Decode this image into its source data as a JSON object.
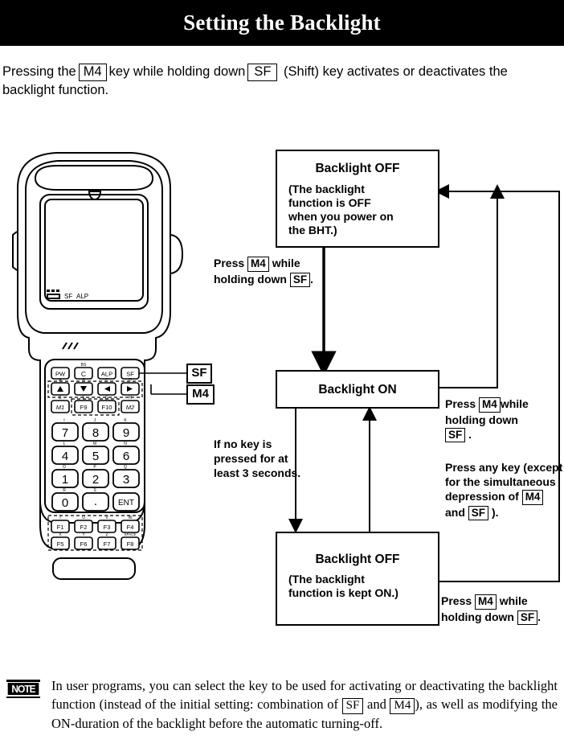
{
  "header": {
    "title": "Setting the Backlight"
  },
  "intro": {
    "part1": "Pressing the",
    "key1": "M4",
    "part2": "key while holding down",
    "key2": "SF",
    "part3": "(Shift) key activates or deactivates the backlight function."
  },
  "device": {
    "name": "BHT handheld terminal",
    "status_indicators": [
      "SF",
      "ALP"
    ],
    "keys": {
      "row_function": [
        "PW",
        "C",
        "ALP",
        "SF"
      ],
      "row_function_shift": [
        "BS"
      ],
      "row_arrows": [
        "up-arrow",
        "down-arrow",
        "left-arrow",
        "right-arrow"
      ],
      "row_arrows_shift": [
        "A",
        "B",
        "C",
        "D"
      ],
      "row_m": [
        "M1",
        "F9",
        "F10",
        "M2"
      ],
      "row_m_shift": [
        "E",
        "F",
        "G",
        "H"
      ],
      "row_789": [
        "7",
        "8",
        "9"
      ],
      "row_789_shift": [
        "I",
        "J",
        "K"
      ],
      "row_456": [
        "4",
        "5",
        "6"
      ],
      "row_456_shift": [
        "L",
        "M",
        "N"
      ],
      "row_123": [
        "1",
        "2",
        "3"
      ],
      "row_123_shift": [
        "O",
        "P",
        "Q"
      ],
      "row_0": [
        "0",
        ".",
        "ENT"
      ],
      "row_0_shift": [
        "R",
        "S"
      ],
      "row_f1": [
        "F1",
        "F2",
        "F3",
        "F4"
      ],
      "row_f1_shift": [
        "T",
        "U",
        "V",
        "W"
      ],
      "row_f5": [
        "F5",
        "F6",
        "F7",
        "F8"
      ],
      "row_f5_shift": [
        "X",
        "Y",
        "Z",
        "SPACE"
      ]
    }
  },
  "callouts": {
    "sf": "SF",
    "m4": "M4"
  },
  "flowchart": {
    "box_off_initial": {
      "title": "Backlight OFF",
      "sub_lines": [
        "(The backlight",
        "function is OFF",
        "when you power on",
        "the BHT.)"
      ]
    },
    "box_on": {
      "title": "Backlight ON"
    },
    "box_off_kept": {
      "title": "Backlight OFF",
      "sub_lines": [
        "(The backlight",
        "function is kept ON.)"
      ]
    },
    "label_on_trigger": {
      "w1": "Press",
      "key1": "M4",
      "w2": "while",
      "w3": "holding down",
      "key2": "SF",
      "w4": "."
    },
    "label_timeout": {
      "lines": [
        "If no key is",
        "pressed for at",
        "least 3 seconds."
      ]
    },
    "label_off_trigger": {
      "w1": "Press",
      "key1": "M4",
      "w2": "while",
      "w3": "holding down",
      "key2": "SF",
      "w4": "."
    },
    "label_anykey": {
      "w1": "Press any key (except",
      "w2": "for the simultaneous",
      "w3": "depression of",
      "key1": "M4",
      "w4": "and",
      "key2": "SF",
      "w5": ")."
    },
    "label_off_to_off": {
      "w1": "Press",
      "key1": "M4",
      "w2": "while",
      "w3": "holding down",
      "key2": "SF",
      "w4": "."
    }
  },
  "note": {
    "badge": "NOTE",
    "t1": "In user programs, you can select the key to be used for activating or deactivating the backlight function (instead of the initial setting: combination of",
    "key1": "SF",
    "t2": "and",
    "key2": "M4",
    "t3": "), as well as modifying the ON-duration of the backlight before the automatic turning-off."
  }
}
